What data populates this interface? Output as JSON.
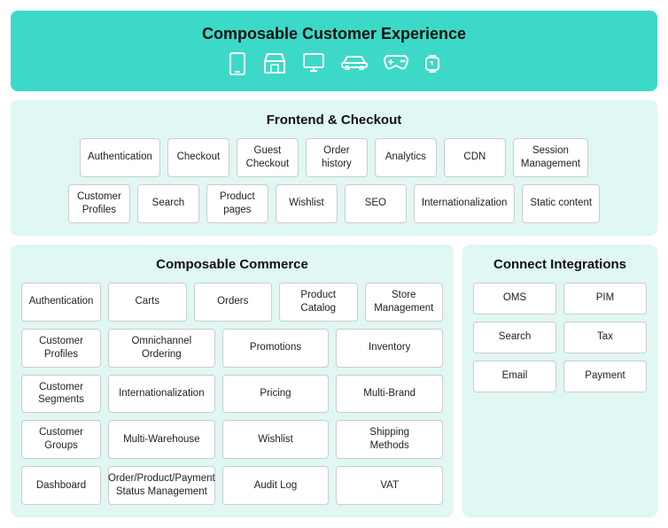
{
  "top": {
    "title": "Composable Customer Experience",
    "icons": [
      "📱",
      "🏪",
      "🖥️",
      "🚗",
      "🎮",
      "📟"
    ]
  },
  "frontend": {
    "title": "Frontend & Checkout",
    "cards_row1": [
      "Authentication",
      "Checkout",
      "Guest\nCheckout",
      "Order\nhistory",
      "Analytics",
      "CDN",
      "Session\nManagement"
    ],
    "cards_row2": [
      "Customer\nProfiles",
      "Search",
      "Product\npages",
      "Wishlist",
      "SEO",
      "Internationalization",
      "Static content"
    ]
  },
  "composable": {
    "title": "Composable Commerce",
    "rows": [
      [
        "Authentication",
        "Carts",
        "Orders",
        "Product\nCatalog",
        "Store\nManagement"
      ],
      [
        "Customer\nProfiles",
        "Omnichannel Ordering",
        "Promotions",
        "Inventory"
      ],
      [
        "Customer\nSegments",
        "Internationalization",
        "Pricing",
        "Multi-Brand"
      ],
      [
        "Customer\nGroups",
        "Multi-Warehouse",
        "Wishlist",
        "Shipping\nMethods"
      ],
      [
        "Dashboard",
        "Order/Product/Payment\nStatus Management",
        "Audit Log",
        "VAT"
      ]
    ]
  },
  "connect": {
    "title": "Connect Integrations",
    "cards": [
      "OMS",
      "PIM",
      "Search",
      "Tax",
      "Email",
      "Payment"
    ]
  }
}
